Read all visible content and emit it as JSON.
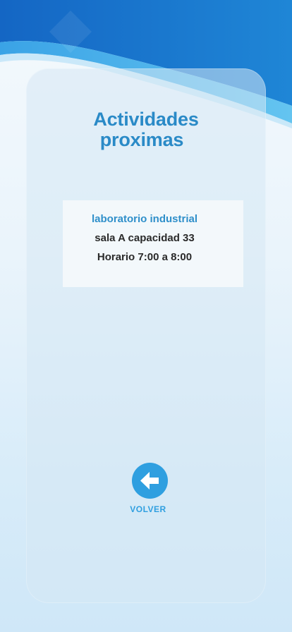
{
  "header": {
    "title_line1": "Actividades",
    "title_line2": "proximas"
  },
  "activity": {
    "name": "laboratorio industrial",
    "room": "sala A capacidad 33",
    "schedule": "Horario 7:00 a 8:00"
  },
  "back": {
    "label": "VOLVER",
    "icon": "arrow-left-icon"
  },
  "colors": {
    "accent": "#2f9fe0",
    "title": "#2a8ac7",
    "wave_dark": "#1976cf",
    "wave_light": "#4fb3ea"
  }
}
